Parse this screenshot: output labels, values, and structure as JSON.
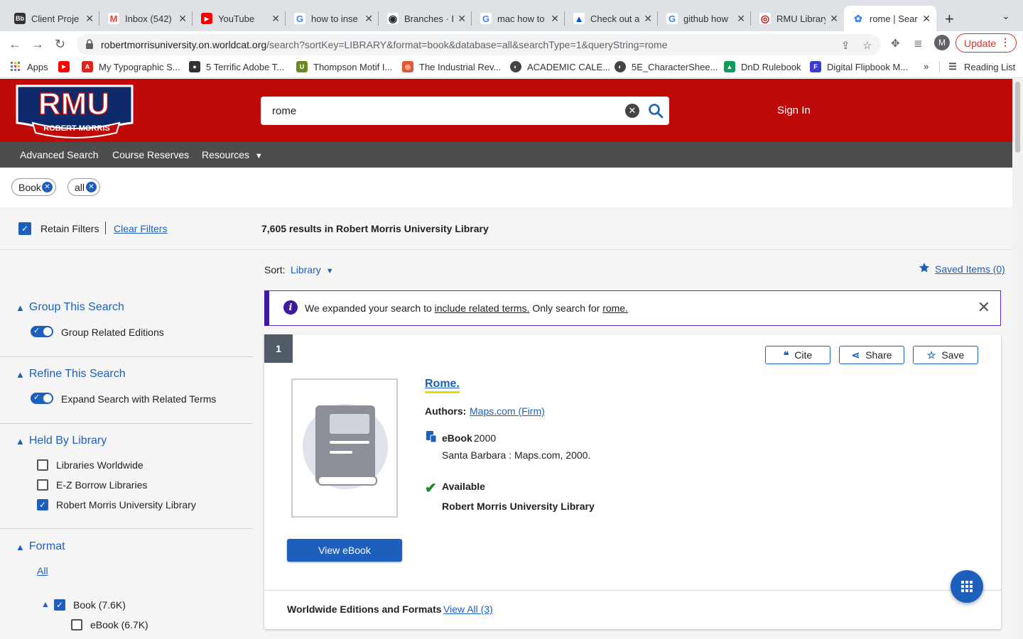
{
  "browser": {
    "tabs": [
      {
        "label": "Client Proje",
        "favicon": "Bb",
        "fav_color": "#333333"
      },
      {
        "label": "Inbox (542)",
        "favicon": "M",
        "fav_color": "#ea4335"
      },
      {
        "label": "YouTube",
        "favicon": "▶",
        "fav_color": "#ff0000"
      },
      {
        "label": "how to inse",
        "favicon": "G",
        "fav_color": "#4285f4"
      },
      {
        "label": "Branches · F",
        "favicon": "◉",
        "fav_color": "#24292f"
      },
      {
        "label": "mac how to",
        "favicon": "G",
        "fav_color": "#4285f4"
      },
      {
        "label": "Check out a",
        "favicon": "▲",
        "fav_color": "#0052cc"
      },
      {
        "label": "github how",
        "favicon": "G",
        "fav_color": "#4285f4"
      },
      {
        "label": "RMU Library",
        "favicon": "◎",
        "fav_color": "#c00a0a"
      },
      {
        "label": "rome | Sear",
        "favicon": "✿",
        "fav_color": "#4285f4"
      }
    ],
    "url_host": "robertmorrisuniversity.on.worldcat.org",
    "url_rest": "/search?sortKey=LIBRARY&format=book&database=all&searchType=1&queryString=rome",
    "avatar_letter": "M",
    "update_label": "Update",
    "bookmarks": [
      {
        "label": "Apps",
        "color": "#4285f4"
      },
      {
        "label": "",
        "color": "#ff0000"
      },
      {
        "label": "My Typographic S...",
        "color": "#e2231a"
      },
      {
        "label": "5 Terrific Adobe T...",
        "color": "#333333"
      },
      {
        "label": "Thompson Motif I...",
        "color": "#6a8a1f"
      },
      {
        "label": "The Industrial Rev...",
        "color": "#e4572e"
      },
      {
        "label": "ACADEMIC CALE...",
        "color": "#444444"
      },
      {
        "label": "5E_CharacterShee...",
        "color": "#444444"
      },
      {
        "label": "DnD Rulebook",
        "color": "#0f9d58"
      },
      {
        "label": "Digital Flipbook M...",
        "color": "#3b3bd6"
      }
    ],
    "bookmarks_more": "»",
    "reading_list": "Reading List"
  },
  "header": {
    "logo_text": "RMU",
    "logo_sub": "ROBERT MORRIS",
    "search_value": "rome",
    "signin_label": "Sign In"
  },
  "subnav": {
    "advanced": "Advanced Search",
    "reserves": "Course Reserves",
    "resources": "Resources"
  },
  "chips": [
    {
      "label": "Book"
    },
    {
      "label": "all"
    }
  ],
  "summary": {
    "retain_label": "Retain Filters",
    "clear_label": "Clear Filters",
    "results_text": "7,605 results in Robert Morris University Library"
  },
  "sidebar": {
    "group_head": "Group This Search",
    "group_toggle": "Group Related Editions",
    "refine_head": "Refine This Search",
    "refine_toggle": "Expand Search with Related Terms",
    "held_head": "Held By Library",
    "held_options": [
      {
        "label": "Libraries Worldwide",
        "checked": false
      },
      {
        "label": "E-Z Borrow Libraries",
        "checked": false
      },
      {
        "label": "Robert Morris University Library",
        "checked": true
      }
    ],
    "format_head": "Format",
    "format_all": "All",
    "format_book": "Book (7.6K)",
    "format_ebook": "eBook (6.7K)"
  },
  "main": {
    "sort_label": "Sort:",
    "sort_value": "Library",
    "saved_items": "Saved Items (0)",
    "notice_pre": "We expanded your search to ",
    "notice_link1": "include related terms.",
    "notice_mid": " Only search for ",
    "notice_link2": "rome."
  },
  "result": {
    "number": "1",
    "cite": "Cite",
    "share": "Share",
    "save": "Save",
    "title": "Rome.",
    "authors_label": "Authors:",
    "author": "Maps.com (Firm)",
    "format": "eBook",
    "year": "2000",
    "publisher": "Santa Barbara : Maps.com, 2000.",
    "availability": "Available",
    "library": "Robert Morris University Library",
    "view_button": "View eBook",
    "worldwide_label": "Worldwide Editions and Formats",
    "view_all": "View All (3)"
  },
  "colors": {
    "brand_red": "#c00a0a",
    "link_blue": "#1c5fbd",
    "notice_purple": "#3d1a9e",
    "available_green": "#1e8a2e"
  }
}
